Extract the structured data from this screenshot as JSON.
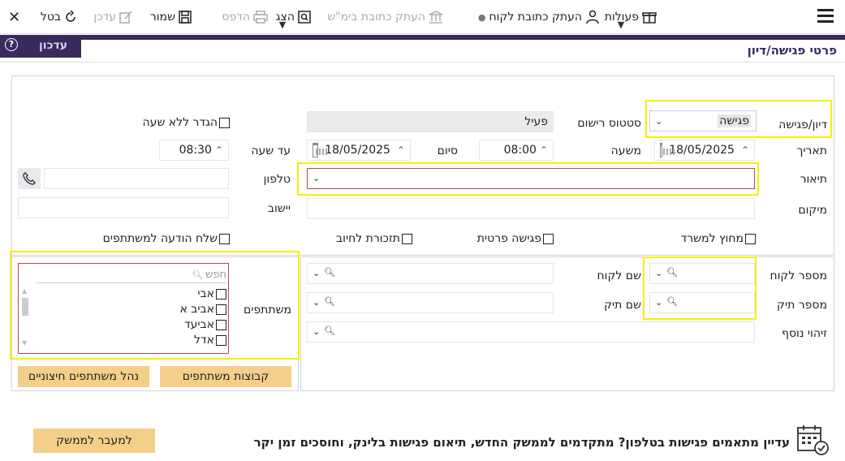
{
  "toolbar": {
    "cancel_label": "בטל",
    "edit_label": "עדכן",
    "save_label": "שמור",
    "print_label": "הדפס",
    "show_label": "הצג",
    "copy_address_court_label": "העתק כתובת בימ\"ש",
    "copy_client_address_label": "העתק כתובת לקוח",
    "actions_label": "פעולות"
  },
  "page": {
    "title": "פרטי פגישה/דיון",
    "edit_tab": "עדכון"
  },
  "form": {
    "meeting_type_label": "דיון/פגישה",
    "meeting_type_value": "פגישה",
    "record_status_label": "סטטוס רישום",
    "record_status_value": "פעיל",
    "no_time_label": "הגדר ללא שעה",
    "date_label": "תאריך",
    "date_value": "18/05/2025",
    "from_time_label": "משעה",
    "from_time_value": "08:00",
    "end_label": "סיום",
    "end_date_value": "18/05/2025",
    "to_time_label": "עד שעה",
    "to_time_value": "08:30",
    "description_label": "תיאור",
    "description_value": "",
    "phone_label": "טלפון",
    "phone_value": "",
    "location_label": "מיקום",
    "location_value": "",
    "settlement_label": "יישוב",
    "settlement_value": "",
    "outside_office_label": "מחוץ למשרד",
    "private_meeting_label": "פגישה פרטית",
    "billing_reminder_label": "תזכורת לחיוב",
    "notify_participants_label": "שלח הודעה למשתתפים"
  },
  "client": {
    "client_number_label": "מספר לקוח",
    "client_name_label": "שם לקוח",
    "case_number_label": "מספר תיק",
    "case_name_label": "שם תיק",
    "extra_id_label": "זיהוי נוסף"
  },
  "participants": {
    "label": "משתתפים",
    "search_placeholder": "חפש",
    "items": [
      "אבי",
      "אביב א",
      "אביעד",
      "אדל"
    ],
    "groups_button": "קבוצות משתתפים",
    "external_button": "נהל משתתפים חיצוניים"
  },
  "footer": {
    "promo_text": "עדיין מתאמים פגישות בטלפון? מתקדמים לממשק החדש, תיאום פגישות בלינק, וחוסכים זמן יקר",
    "switch_button": "למעבר לממשק"
  },
  "colors": {
    "header_band": "#3a2a5c",
    "accent_gold": "#f4cf8a",
    "highlight": "#f5f000",
    "error_border": "#b44a4a"
  }
}
